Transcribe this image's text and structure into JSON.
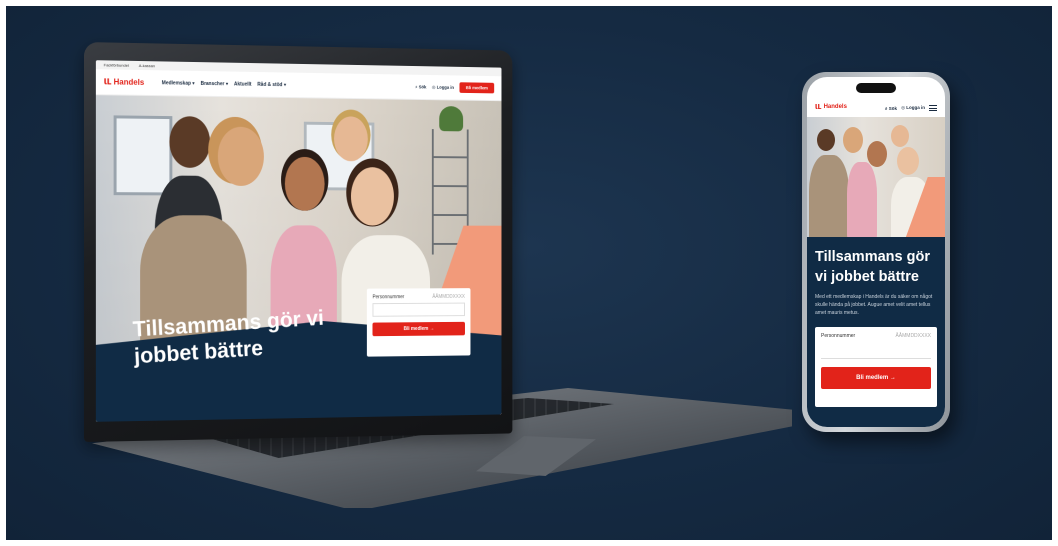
{
  "laptop": {
    "utility_links": [
      "Fackförbundet",
      "A-kassan"
    ],
    "logo_text": "Handels",
    "nav": [
      "Medlemskap ▾",
      "Branscher ▾",
      "Aktuellt",
      "Råd & stöd ▾"
    ],
    "search_label": "Sök",
    "login_label": "Logga in",
    "cta_label": "Bli medlem",
    "hero_title": "Tillsammans gör vi jobbet bättre",
    "form": {
      "field_label": "Personnummer",
      "field_placeholder": "ÅÅMMDDXXXX",
      "button_label": "Bli medlem →"
    }
  },
  "phone": {
    "logo_text": "Handels",
    "search_label": "Sök",
    "login_label": "Logga in",
    "hero_title": "Tillsammans gör vi jobbet bättre",
    "body_text": "Med ett medlemskap i Handels är du säker om något skulle hända på jobbet. Augue amet velit amet tellus amet mauris metus.",
    "form": {
      "field_label": "Personnummer",
      "field_placeholder": "ÅÅMMDDXXXX",
      "button_label": "Bli medlem →"
    }
  },
  "colors": {
    "background": "#152a42",
    "brand_red": "#e2231a",
    "navy": "#102b45",
    "salmon": "#f29a7a"
  }
}
